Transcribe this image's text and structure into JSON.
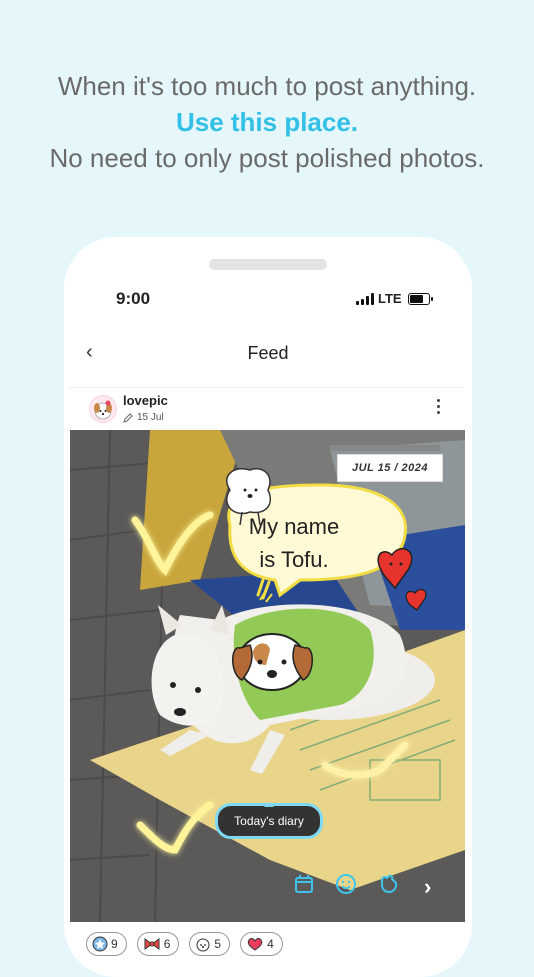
{
  "headline": {
    "line1": "When it's too much to post anything.",
    "line2": "Use this place.",
    "line3": "No need to only post polished photos."
  },
  "status_bar": {
    "time": "9:00",
    "network": "LTE"
  },
  "nav": {
    "back_icon": "chevron-left-icon",
    "title": "Feed"
  },
  "post": {
    "username": "lovepic",
    "date": "15 Jul",
    "more_icon": "more-vertical-icon",
    "photo": {
      "date_sign": "JUL 15 / 2024",
      "bubble": {
        "line1": "My name",
        "line2": "is Tofu."
      },
      "tooltip": "Today's diary",
      "overlay_icons": [
        "calendar-icon",
        "smiley-icon",
        "sticker-icon",
        "chevron-right-icon"
      ]
    }
  },
  "reactions": [
    {
      "icon": "star-badge-icon",
      "count": "9"
    },
    {
      "icon": "ribbon-icon",
      "count": "6"
    },
    {
      "icon": "dog-icon",
      "count": "5"
    },
    {
      "icon": "heart-icon",
      "count": "4"
    }
  ],
  "colors": {
    "accent": "#32c0e6",
    "background": "#e6f7fc",
    "tooltip_border": "#7fd9f5"
  }
}
